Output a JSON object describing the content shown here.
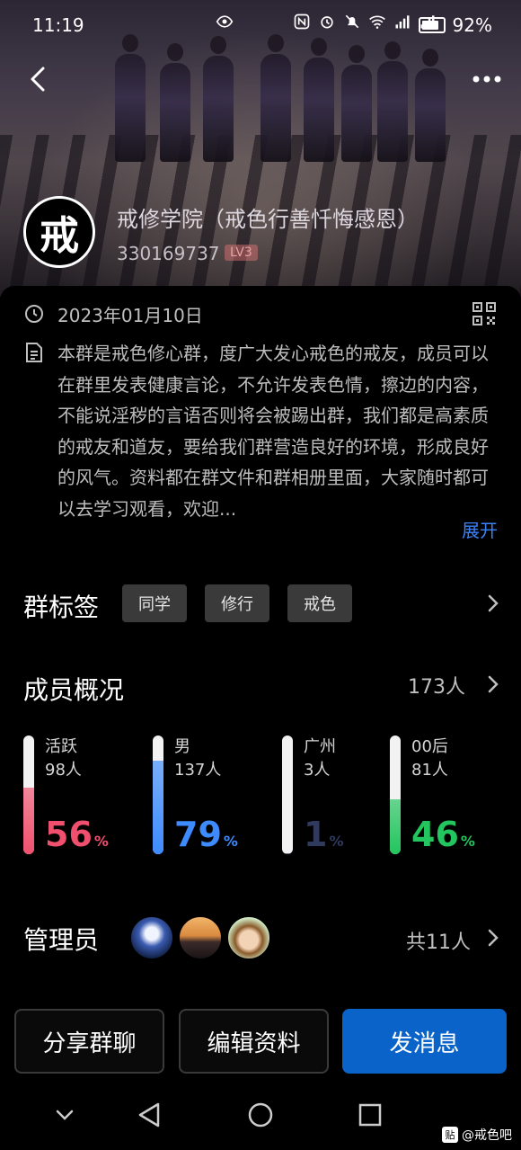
{
  "status_bar": {
    "time": "11:19",
    "battery": "92%"
  },
  "group": {
    "name": "戒修学院（戒色行善忏悔感恩）",
    "logo_char": "戒",
    "id": "330169737",
    "level": "LV3",
    "created_date": "2023年01月10日",
    "description": "本群是戒色修心群，度广大发心戒色的戒友，成员可以在群里发表健康言论，不允许发表色情，擦边的内容，不能说淫秽的言语否则将会被踢出群，我们都是高素质的戒友和道友，要给我们群营造良好的环境，形成良好的风气。资料都在群文件和群相册里面，大家随时都可以去学习观看，欢迎...",
    "expand_label": "展开"
  },
  "tags": {
    "title": "群标签",
    "items": [
      "同学",
      "修行",
      "戒色"
    ]
  },
  "members": {
    "title": "成员概况",
    "total": "173人",
    "stats": [
      {
        "label": "活跃",
        "count": "98人",
        "percent": "56",
        "unit": "%",
        "color": "#f0506e"
      },
      {
        "label": "男",
        "count": "137人",
        "percent": "79",
        "unit": "%",
        "color": "#3d8bff"
      },
      {
        "label": "广州",
        "count": "3人",
        "percent": "1",
        "unit": "%",
        "color": "#2f3a5e"
      },
      {
        "label": "00后",
        "count": "81人",
        "percent": "46",
        "unit": "%",
        "color": "#22c55e"
      }
    ]
  },
  "admins": {
    "title": "管理员",
    "total": "共11人"
  },
  "actions": {
    "share": "分享群聊",
    "edit": "编辑资料",
    "message": "发消息"
  },
  "watermark": {
    "badge": "贴",
    "text": "@戒色吧"
  },
  "colors": {
    "accent": "#0a63c9",
    "link": "#3b82f6"
  }
}
